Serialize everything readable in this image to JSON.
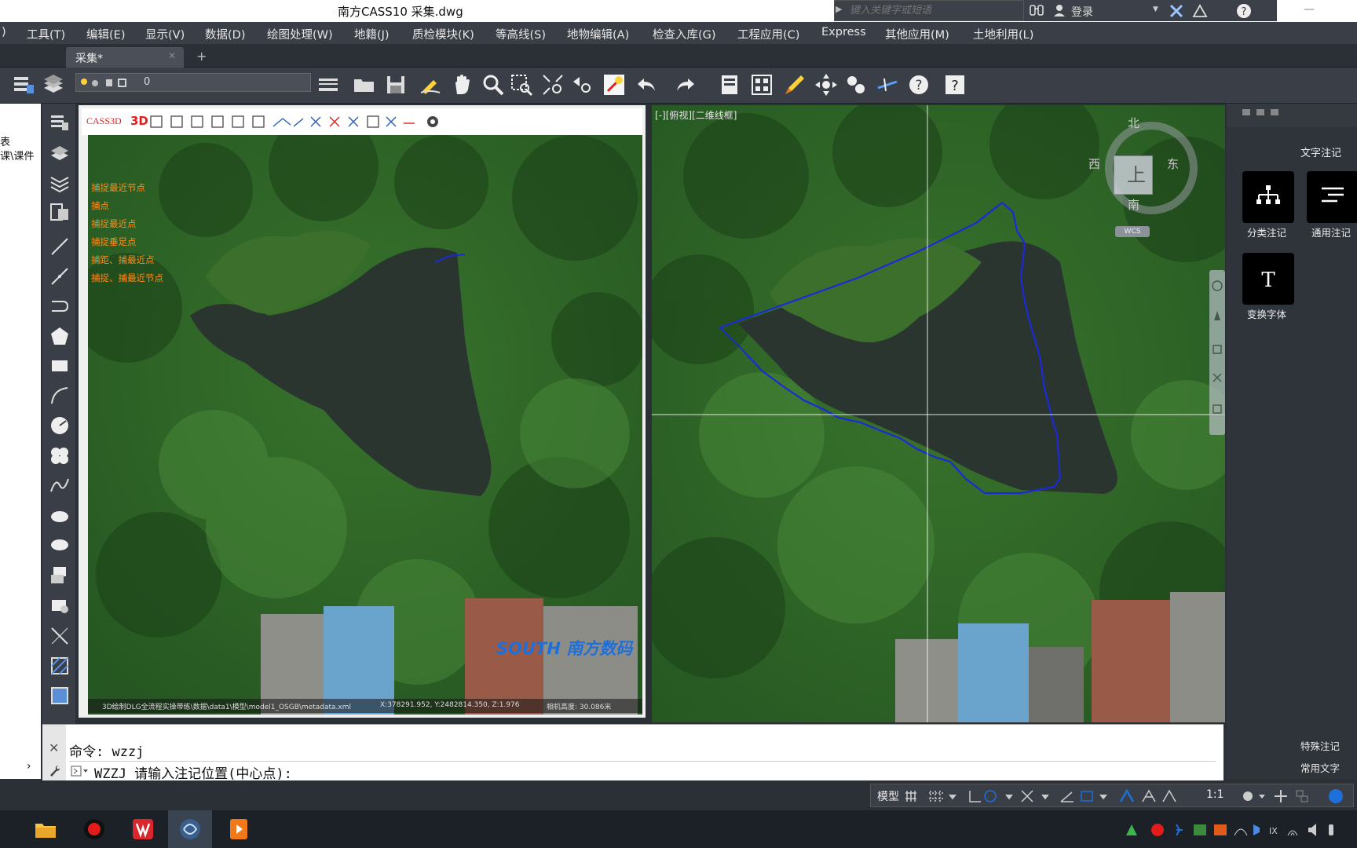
{
  "window": {
    "title": "南方CASS10    采集.dwg",
    "search_placeholder": "键入关键字或短语",
    "login_label": "登录"
  },
  "menu": {
    "items": [
      "工具(T)",
      "编辑(E)",
      "显示(V)",
      "数据(D)",
      "绘图处理(W)",
      "地籍(J)",
      "质检模块(K)",
      "等高线(S)",
      "地物编辑(A)",
      "检查入库(G)",
      "工程应用(C)",
      "Express",
      "其他应用(M)",
      "土地利用(L)"
    ],
    "first_fragment": ")"
  },
  "tabs": {
    "active_label": "采集*",
    "new_tab": "+"
  },
  "toolbar": {
    "layer_value": "0"
  },
  "left_panel": {
    "line1": "表",
    "line2": "课\\课件"
  },
  "left_viewport": {
    "brand": "CASS3D",
    "mode_3d": "3D",
    "snap_labels": [
      "捕捉最近节点",
      "捕点",
      "捕捉最近点",
      "捕捉垂足点",
      "捕距、捕最近点",
      "捕捉、捕最近节点"
    ],
    "status_path": "3D绘制DLG全流程实操带练\\数据\\data1\\模型\\model1_OSGB\\metadata.xml",
    "status_coords": "X:378291.952, Y:2482814.350, Z:1.976",
    "status_camera": "相机高度: 30.086米",
    "watermark": "SOUTH 南方数码"
  },
  "right_viewport": {
    "view_label": "[-][俯视][二维线框]",
    "compass": {
      "north": "北",
      "south": "南",
      "east": "东",
      "west": "西",
      "center": "上",
      "wcs": "WCS"
    }
  },
  "right_panel": {
    "header": "文字注记",
    "tiles": [
      {
        "label": "分类注记",
        "icon": "hierarchy-icon"
      },
      {
        "label": "通用注记",
        "icon": "text-lines-icon"
      },
      {
        "label": "变换字体",
        "icon": "font-t-icon"
      }
    ],
    "footer1": "特殊注记",
    "footer2": "常用文字"
  },
  "command": {
    "history": "命令: wzzj",
    "prompt": "WZZJ 请输入注记位置(中心点):"
  },
  "status": {
    "model": "模型",
    "scale": "1:1"
  },
  "colors": {
    "boundary_line": "#1a2ad8",
    "snap_text": "#ff8c1a",
    "accent": "#1e6fd9"
  }
}
